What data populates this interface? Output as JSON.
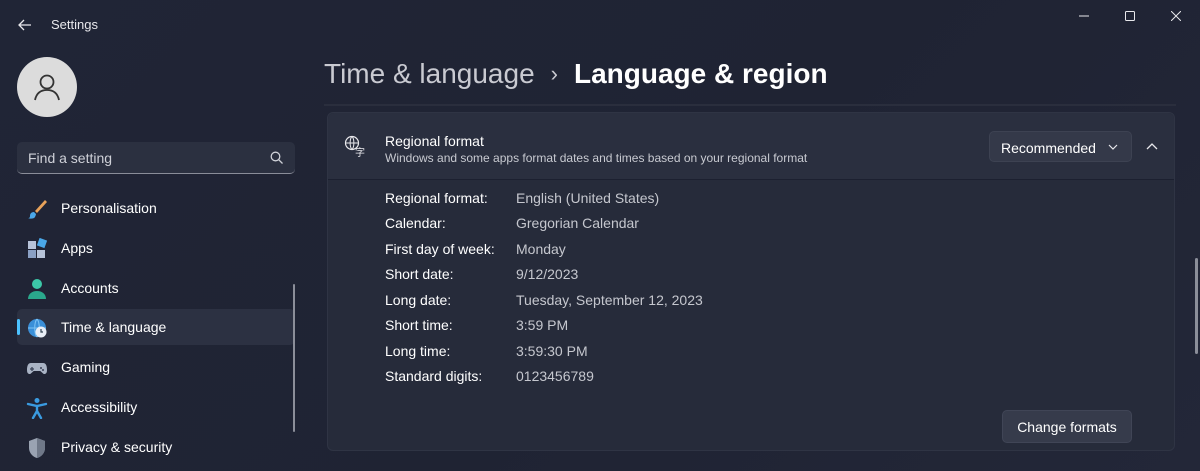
{
  "window": {
    "title": "Settings"
  },
  "sidebar": {
    "search": {
      "placeholder": "Find a setting"
    },
    "items": [
      {
        "label": "Personalisation",
        "icon": "paintbrush-icon",
        "active": false
      },
      {
        "label": "Apps",
        "icon": "apps-icon",
        "active": false
      },
      {
        "label": "Accounts",
        "icon": "accounts-icon",
        "active": false
      },
      {
        "label": "Time & language",
        "icon": "globe-clock-icon",
        "active": true
      },
      {
        "label": "Gaming",
        "icon": "gamepad-icon",
        "active": false
      },
      {
        "label": "Accessibility",
        "icon": "accessibility-icon",
        "active": false
      },
      {
        "label": "Privacy & security",
        "icon": "shield-icon",
        "active": false
      }
    ]
  },
  "breadcrumb": {
    "parent": "Time & language",
    "separator": "›",
    "current": "Language & region"
  },
  "regional_format": {
    "title": "Regional format",
    "description": "Windows and some apps format dates and times based on your regional format",
    "dropdown_value": "Recommended",
    "rows": [
      {
        "key": "Regional format:",
        "value": "English (United States)"
      },
      {
        "key": "Calendar:",
        "value": "Gregorian Calendar"
      },
      {
        "key": "First day of week:",
        "value": "Monday"
      },
      {
        "key": "Short date:",
        "value": "9/12/2023"
      },
      {
        "key": "Long date:",
        "value": "Tuesday, September 12, 2023"
      },
      {
        "key": "Short time:",
        "value": "3:59 PM"
      },
      {
        "key": "Long time:",
        "value": "3:59:30 PM"
      },
      {
        "key": "Standard digits:",
        "value": "0123456789"
      }
    ],
    "change_button": "Change formats"
  },
  "colors": {
    "accent": "#4cc2ff",
    "background": "#202536",
    "card": "#262b3a"
  }
}
